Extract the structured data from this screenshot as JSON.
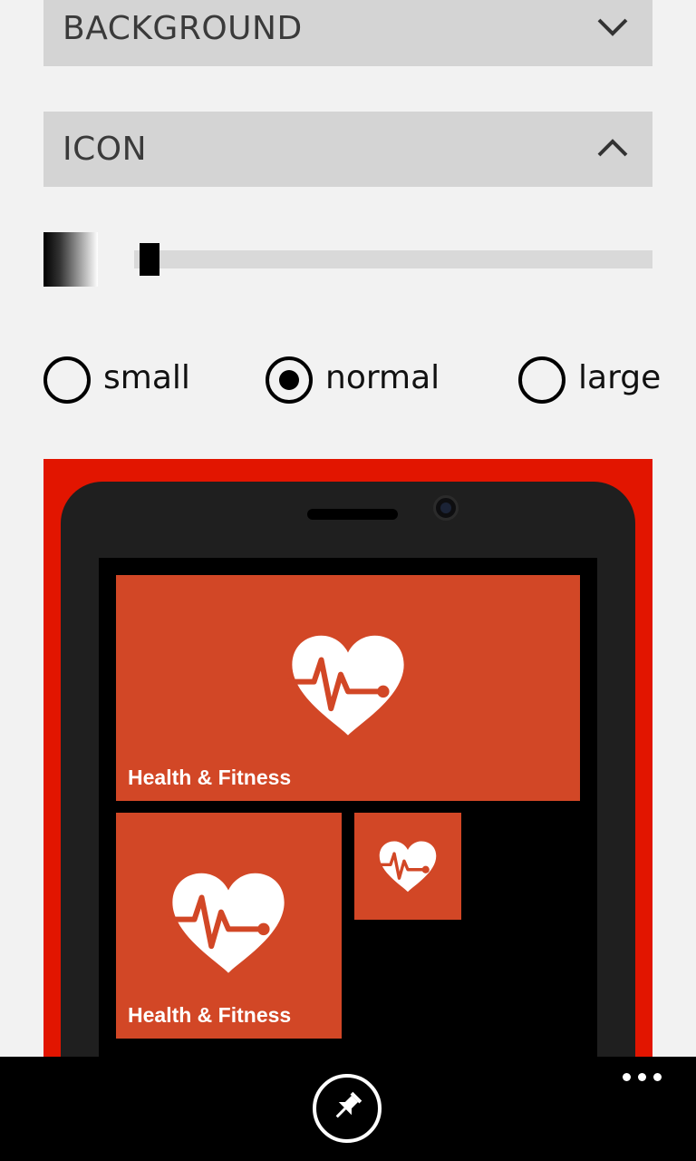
{
  "sections": {
    "background": {
      "label": "BACKGROUND",
      "icon": "chevron-down-icon"
    },
    "icon": {
      "label": "ICON",
      "icon": "chevron-up-icon"
    }
  },
  "slider": {
    "value_fraction": 0.01
  },
  "size_options": [
    {
      "label": "small",
      "selected": false
    },
    {
      "label": "normal",
      "selected": true
    },
    {
      "label": "large",
      "selected": false
    }
  ],
  "preview": {
    "frame_color": "#e21500",
    "tile_color": "#d24726",
    "tiles": {
      "wide": {
        "label": "Health & Fitness",
        "icon": "heart-pulse-icon"
      },
      "medium": {
        "label": "Health & Fitness",
        "icon": "heart-pulse-icon"
      },
      "small": {
        "icon": "heart-pulse-icon"
      }
    }
  },
  "appbar": {
    "pin_icon": "pin-icon",
    "more_icon": "more-icon"
  }
}
